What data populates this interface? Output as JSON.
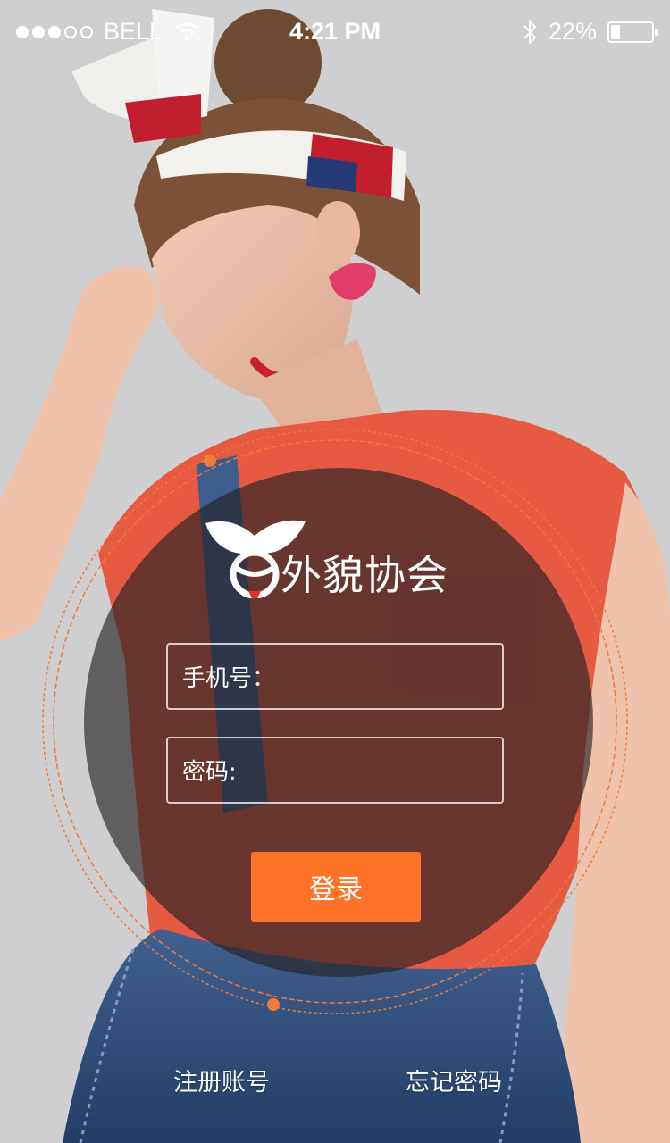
{
  "status_bar": {
    "carrier": "BELL",
    "time": "4:21 PM",
    "battery_percent": "22%",
    "battery_level": 0.22,
    "icons": [
      "signal-dots-icon",
      "wifi-icon",
      "bluetooth-icon",
      "battery-icon"
    ]
  },
  "brand": {
    "name": "外貌协会",
    "logo_icon": "fox-face-logo-icon"
  },
  "form": {
    "phone_label": "手机号：",
    "phone_value": "",
    "password_label": "密码:",
    "password_value": "",
    "login_label": "登录"
  },
  "links": {
    "register": "注册账号",
    "forgot_password": "忘记密码"
  },
  "colors": {
    "accent": "#ff7328",
    "panel": "#2a2427"
  }
}
